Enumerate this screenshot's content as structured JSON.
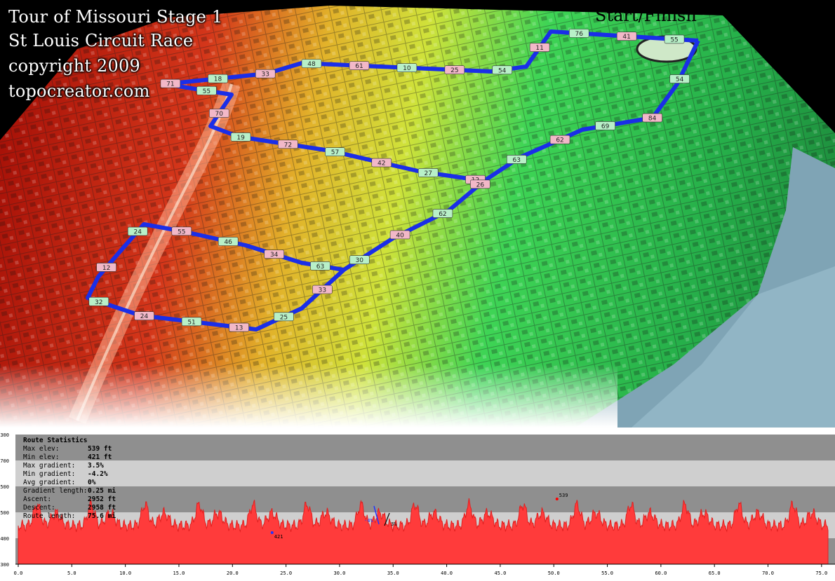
{
  "title_lines": [
    "Tour of Missouri Stage 1",
    "St Louis Circuit Race",
    "copyright 2009",
    "topocreator.com"
  ],
  "start_finish": "Start/Finish",
  "route_markers": [
    "55",
    "41",
    "76",
    "11",
    "54",
    "25",
    "10",
    "61",
    "48",
    "33",
    "18",
    "71",
    "55",
    "70",
    "19",
    "72",
    "57",
    "42",
    "27",
    "12",
    "63",
    "62",
    "69",
    "84",
    "54",
    "26",
    "62",
    "40",
    "30",
    "33",
    "25",
    "13",
    "51",
    "24",
    "32",
    "12",
    "24",
    "55",
    "46",
    "34",
    "63"
  ],
  "colors": {
    "route": "#1a2ee8",
    "low_elev": "#2ad35a",
    "high_elev": "#d41e10",
    "profile_fill": "#ff3b3b",
    "river": "#7fa4b5"
  },
  "stats": {
    "header": "Route Statistics",
    "rows": [
      {
        "label": "Max elev:",
        "value": "539 ft"
      },
      {
        "label": "Min elev:",
        "value": "421 ft"
      },
      {
        "label": "Max gradient:",
        "value": "3.5%"
      },
      {
        "label": "Min gradient:",
        "value": "-4.2%"
      },
      {
        "label": "Avg gradient:",
        "value": "0%"
      },
      {
        "label": "Gradient length:",
        "value": "0.25 mi"
      },
      {
        "label": "Ascent:",
        "value": "2952 ft"
      },
      {
        "label": "Descent:",
        "value": "2958 ft"
      },
      {
        "label": "Route length:",
        "value": "75.6 mi"
      }
    ]
  },
  "profile": {
    "x_ticks": [
      "0.0",
      "5.0",
      "10.0",
      "15.0",
      "20.0",
      "25.0",
      "30.0",
      "35.0",
      "40.0",
      "45.0",
      "50.0",
      "55.0",
      "60.0",
      "65.0",
      "70.0",
      "75.0"
    ],
    "y_ticks": [
      "300",
      "700",
      "500",
      "500",
      "400",
      "300"
    ],
    "x_max_mi": 75.6,
    "max_label": "539",
    "min_label": "421",
    "max_at_mi": 50.3,
    "min_at_mi": 23.7,
    "grad_neg_label": "-4%",
    "grad_pos_label": "3%"
  }
}
